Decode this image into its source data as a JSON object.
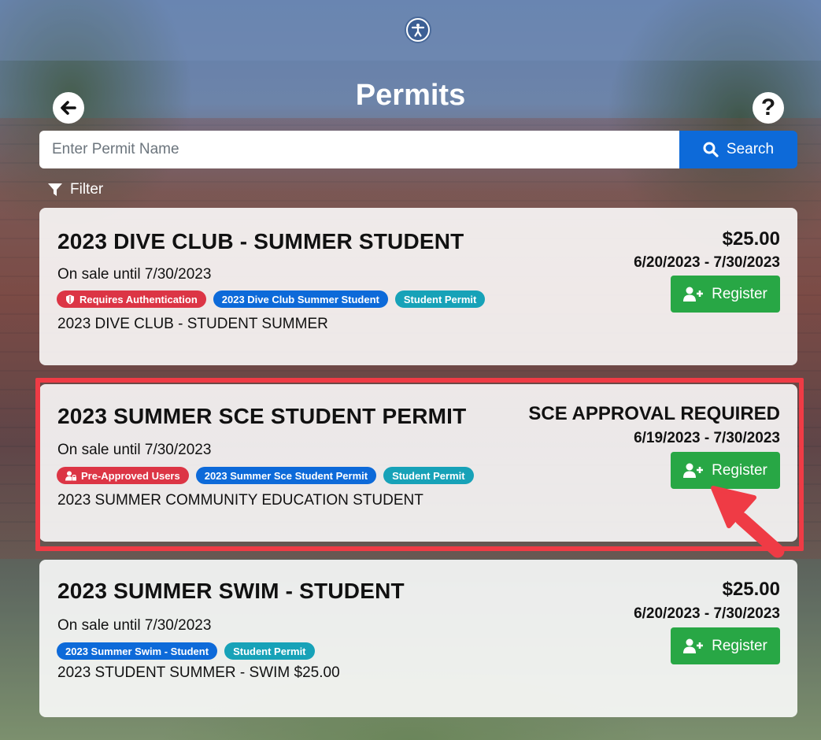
{
  "header": {
    "title": "Permits",
    "back_icon": "arrow-left-icon",
    "help_icon": "question-icon",
    "help_label": "?",
    "accessibility_icon": "accessibility-icon"
  },
  "search": {
    "placeholder": "Enter Permit Name",
    "value": "",
    "button_label": "Search",
    "button_icon": "search-icon"
  },
  "filter": {
    "label": "Filter",
    "icon": "filter-icon"
  },
  "permits": [
    {
      "title": "2023 DIVE CLUB - SUMMER STUDENT",
      "sale_text": "On sale until 7/30/2023",
      "tags": [
        {
          "label": "Requires Authentication",
          "color": "#dc3545",
          "icon": "shield-icon"
        },
        {
          "label": "2023 Dive Club Summer Student",
          "color": "#0d6ad9"
        },
        {
          "label": "Student Permit",
          "color": "#17a2b8"
        }
      ],
      "description": "2023 DIVE CLUB - STUDENT SUMMER",
      "price": "$25.00",
      "dates": "6/20/2023 - 7/30/2023",
      "register_label": "Register"
    },
    {
      "title": "2023 SUMMER SCE STUDENT PERMIT",
      "sale_text": "On sale until 7/30/2023",
      "tags": [
        {
          "label": "Pre-Approved Users",
          "color": "#dc3545",
          "icon": "user-lock-icon"
        },
        {
          "label": "2023 Summer Sce Student Permit",
          "color": "#0d6ad9"
        },
        {
          "label": "Student Permit",
          "color": "#17a2b8"
        }
      ],
      "description": "2023 SUMMER COMMUNITY EDUCATION STUDENT",
      "price": "SCE APPROVAL REQUIRED",
      "dates": "6/19/2023 - 7/30/2023",
      "register_label": "Register"
    },
    {
      "title": "2023 SUMMER SWIM - STUDENT",
      "sale_text": "On sale until 7/30/2023",
      "tags": [
        {
          "label": "2023 Summer Swim - Student",
          "color": "#0d6ad9"
        },
        {
          "label": "Student Permit",
          "color": "#17a2b8"
        }
      ],
      "description": "2023 STUDENT SUMMER - SWIM $25.00",
      "price": "$25.00",
      "dates": "6/20/2023 - 7/30/2023",
      "register_label": "Register"
    }
  ],
  "annotation": {
    "highlight_color": "#ef3b45"
  }
}
